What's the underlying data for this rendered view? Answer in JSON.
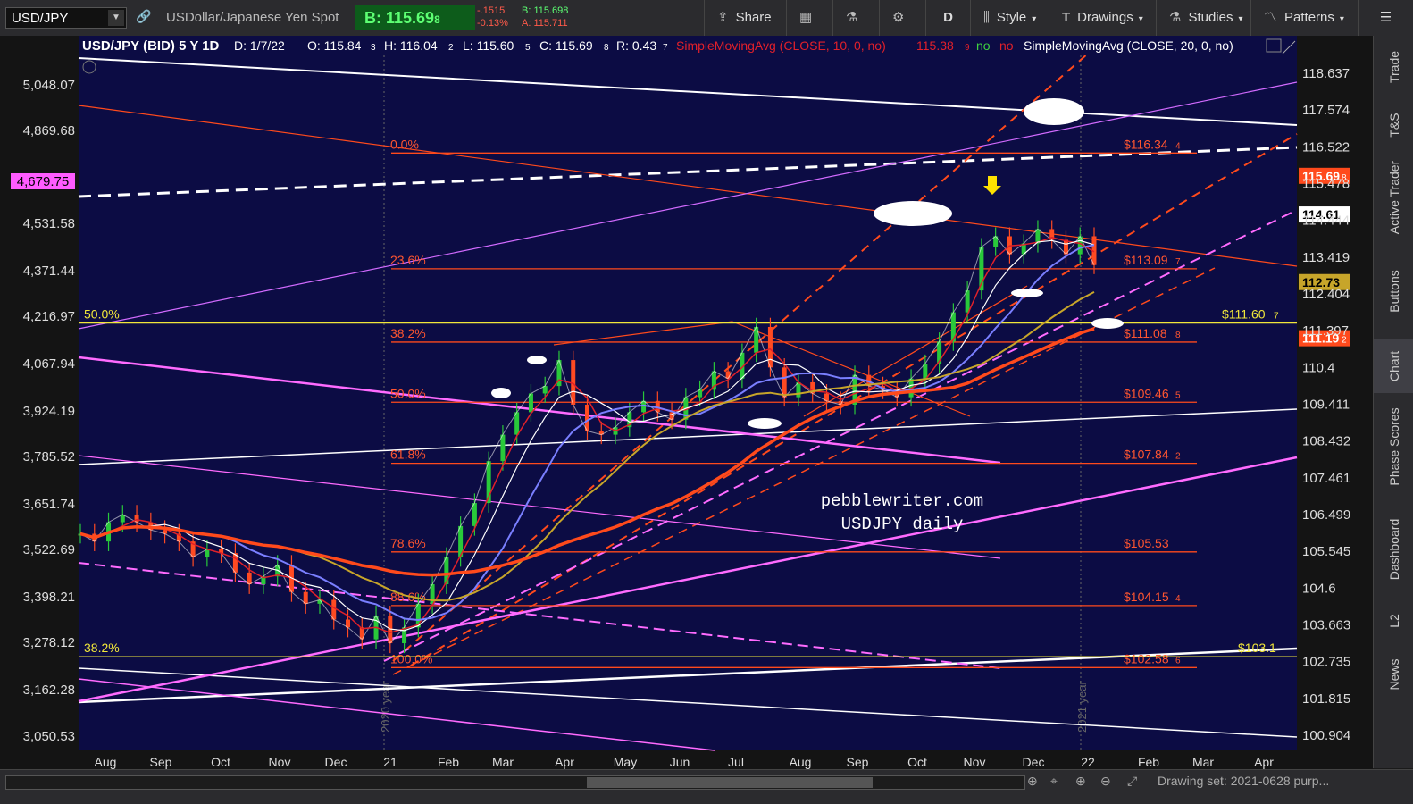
{
  "toolbar": {
    "symbol": "USD/JPY",
    "description": "USDollar/Japanese Yen Spot",
    "bid_label": "B: 115.69",
    "bid_sub": "8",
    "change": "-.1515",
    "change_pct": "-0.13%",
    "bid_small": "B: 115.698",
    "ask_small": "A: 115.711",
    "share": "Share",
    "period": "D",
    "style": "Style",
    "drawings": "Drawings",
    "studies": "Studies",
    "patterns": "Patterns"
  },
  "header": {
    "title": "USD/JPY (BID) 5 Y 1D",
    "date": "D: 1/7/22",
    "open": "O: 115.84",
    "open_sub": "3",
    "high": "H: 116.04",
    "high_sub": "2",
    "low": "L: 115.60",
    "low_sub": "5",
    "close": "C: 115.69",
    "close_sub": "8",
    "range": "R: 0.43",
    "range_sub": "7",
    "sma10": "SimpleMovingAvg (CLOSE, 10, 0, no)",
    "sma10_val": "115.38",
    "sma10_sub": "9",
    "no1": "no",
    "no2": "no",
    "sma20": "SimpleMovingAvg (CLOSE, 20, 0, no)"
  },
  "right_tabs": [
    "Trade",
    "T&S",
    "Active Trader",
    "Buttons",
    "Chart",
    "Phase Scores",
    "Dashboard",
    "L2",
    "News"
  ],
  "bottom": {
    "drawing_set": "Drawing set: 2021-0628 purp..."
  },
  "colors": {
    "background": "#0c0c44",
    "fib": "#ff4a1c",
    "fib_text": "#ff5530",
    "yellow": "#f1e73a",
    "up_candle": "#29c93a",
    "down_candle": "#ff4a22",
    "sma10": "#e0202a",
    "sma20": "#ffffff",
    "sma50": "#7a7fff",
    "sma100": "#c7a52a",
    "sma200": "#ff4a1c",
    "spx": "#c567ff",
    "magenta": "#ff6bff",
    "white": "#ffffff"
  },
  "chart_data": {
    "type": "line",
    "title": "USD/JPY (BID) 5 Y 1D",
    "annotation": [
      "pebblewriter.com",
      "USDJPY daily"
    ],
    "x_labels": [
      "Aug",
      "Sep",
      "Oct",
      "Nov",
      "Dec",
      "21",
      "Feb",
      "Mar",
      "Apr",
      "May",
      "Jun",
      "Jul",
      "Aug",
      "Sep",
      "Oct",
      "Nov",
      "Dec",
      "22",
      "Feb",
      "Mar",
      "Apr"
    ],
    "year_markers": [
      "2020 year",
      "2021 year"
    ],
    "y_right": {
      "ticks": [
        118.637,
        117.574,
        116.522,
        115.478,
        114.444,
        113.419,
        112.404,
        111.397,
        110.4,
        109.411,
        108.432,
        107.461,
        106.499,
        105.545,
        104.6,
        103.663,
        102.735,
        101.815,
        100.904
      ],
      "labels": [
        "118.637",
        "117.574",
        "116.522",
        "115.478",
        "114.444",
        "113.419",
        "112.404",
        "111.397",
        "110.4",
        "109.411",
        "108.432",
        "107.461",
        "106.499",
        "105.545",
        "104.6",
        "103.663",
        "102.735",
        "101.815",
        "100.904"
      ],
      "range": [
        100.7,
        119.0
      ]
    },
    "y_left": {
      "labels": [
        "5,048.07",
        "4,869.68",
        "4,531.58",
        "4,371.44",
        "4,216.97",
        "4,067.94",
        "3,924.19",
        "3,785.52",
        "3,651.74",
        "3,522.69",
        "3,398.21",
        "3,278.12",
        "3,162.28",
        "3,050.53"
      ],
      "current": "4,679.75"
    },
    "price_badges": [
      {
        "text": "115.69",
        "sub": "8",
        "value": 115.698,
        "color": "#ff4a1c",
        "text_color": "#ffffff"
      },
      {
        "text": "114.61",
        "value": 114.61,
        "color": "#ffffff",
        "text_color": "#000000"
      },
      {
        "text": "112.73",
        "value": 112.73,
        "color": "#c7a52a",
        "text_color": "#000000"
      },
      {
        "text": "111.19",
        "sub": "2",
        "value": 111.192,
        "color": "#ff4a1c",
        "text_color": "#ffffff"
      }
    ],
    "fib_levels": [
      {
        "label": "0.0%",
        "value": 116.344,
        "price": "$116.34",
        "sub": "4"
      },
      {
        "label": "23.6%",
        "value": 113.097,
        "price": "$113.09",
        "sub": "7"
      },
      {
        "label": "38.2%",
        "value": 111.088,
        "price": "$111.08",
        "sub": "8"
      },
      {
        "label": "50.0%",
        "value": 109.465,
        "price": "$109.46",
        "sub": "5"
      },
      {
        "label": "61.8%",
        "value": 107.842,
        "price": "$107.84",
        "sub": "2"
      },
      {
        "label": "78.6%",
        "value": 105.53,
        "price": "$105.53",
        "sub": ""
      },
      {
        "label": "88.6%",
        "value": 104.154,
        "price": "$104.15",
        "sub": "4"
      },
      {
        "label": "100.0%",
        "value": 102.586,
        "price": "$102.58",
        "sub": "6"
      }
    ],
    "yellow_levels": [
      {
        "label": "50.0%",
        "value": 111.607,
        "price": "$111.60",
        "sub": "7"
      },
      {
        "label": "38.2%",
        "value": 102.86,
        "price": "$103.1",
        "sub": ""
      }
    ],
    "series": [
      {
        "name": "USD/JPY",
        "x": [
          0,
          10,
          20,
          30,
          40,
          50,
          60,
          70,
          80,
          90,
          100,
          110,
          120,
          130,
          140,
          150,
          160,
          170,
          180,
          190,
          200,
          210,
          220,
          230,
          240,
          250,
          260,
          270,
          280,
          290,
          300,
          310,
          320,
          330,
          340,
          350,
          360,
          370,
          380,
          390,
          400,
          410,
          420,
          430,
          440,
          450,
          460,
          470,
          480,
          490,
          500,
          510,
          520,
          530,
          540,
          550,
          560,
          570,
          580,
          590,
          600,
          610,
          620,
          630,
          640,
          650,
          660,
          670,
          680,
          690,
          700,
          710,
          720
        ],
        "y": [
          106.0,
          105.8,
          106.3,
          106.5,
          106.3,
          106.1,
          106.0,
          105.8,
          105.4,
          105.6,
          105.5,
          105.0,
          104.7,
          104.9,
          105.2,
          104.5,
          104.2,
          104.3,
          103.8,
          103.6,
          103.3,
          103.9,
          103.2,
          103.6,
          104.2,
          104.7,
          105.4,
          106.2,
          106.8,
          107.9,
          108.6,
          109.2,
          109.7,
          109.9,
          110.6,
          109.4,
          108.7,
          108.6,
          108.8,
          109.2,
          109.5,
          109.2,
          109.0,
          109.6,
          109.8,
          110.3,
          110.1,
          110.8,
          111.5,
          110.4,
          109.6,
          110.0,
          109.7,
          109.5,
          109.4,
          110.2,
          109.9,
          109.8,
          109.6,
          110.1,
          110.5,
          111.1,
          111.9,
          112.5,
          113.7,
          114.0,
          113.5,
          113.8,
          114.2,
          113.9,
          113.5,
          114.0,
          113.2
        ]
      }
    ]
  }
}
